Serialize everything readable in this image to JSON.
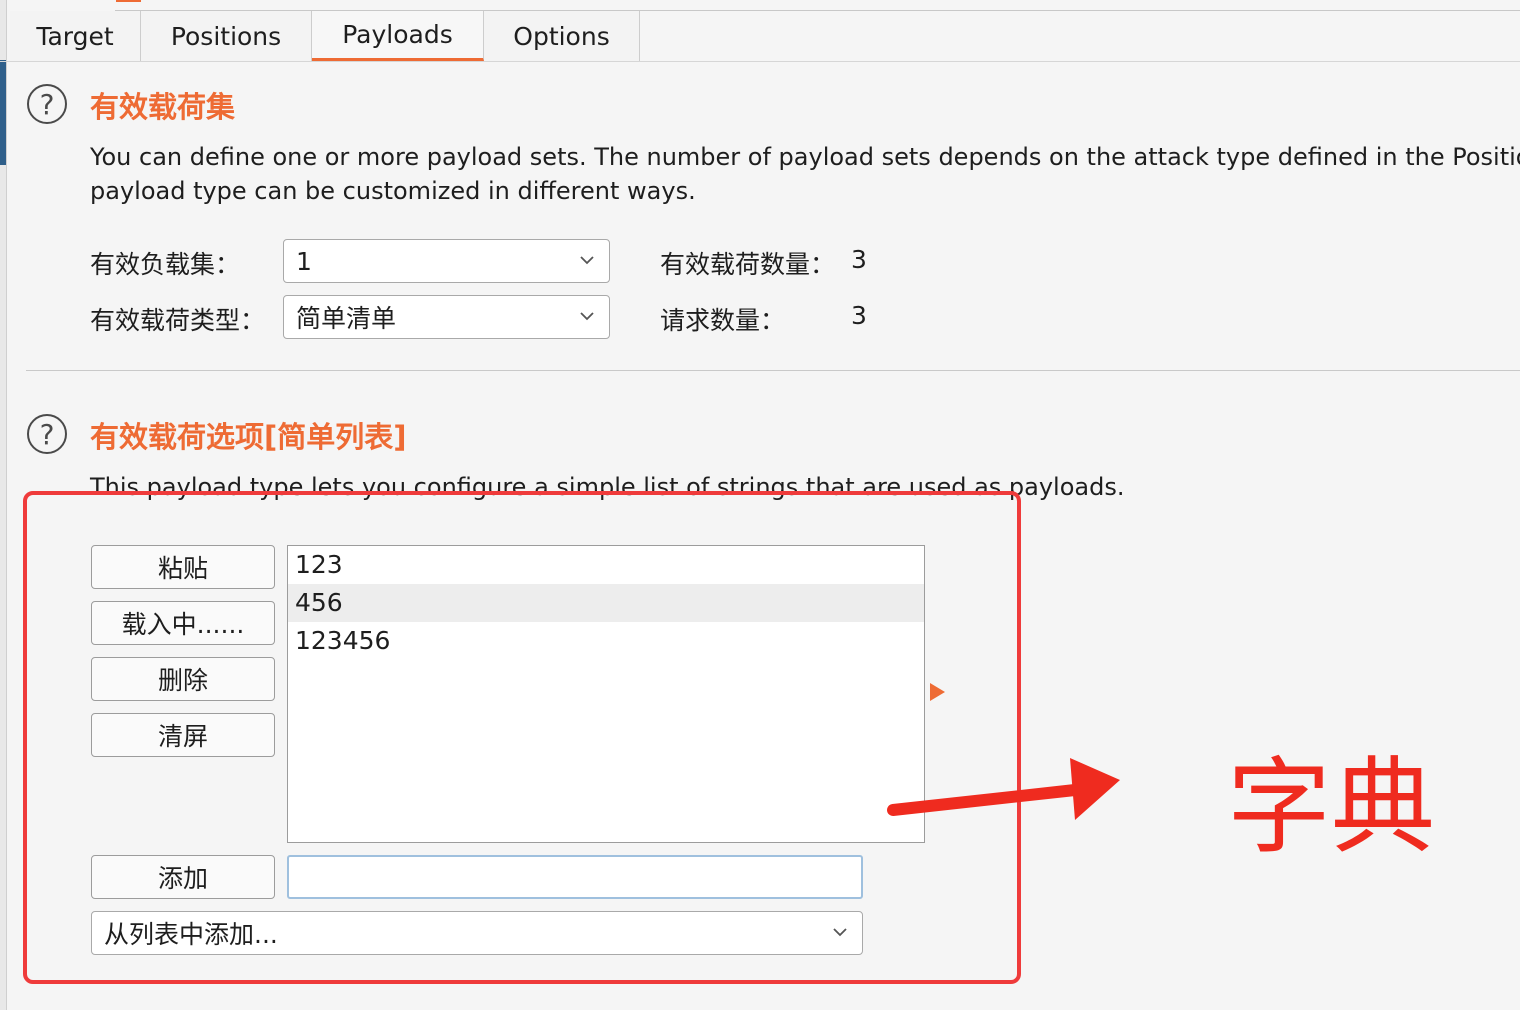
{
  "tabs": [
    {
      "label": "Target"
    },
    {
      "label": "Positions"
    },
    {
      "label": "Payloads",
      "active": true
    },
    {
      "label": "Options"
    }
  ],
  "payload_sets": {
    "help_icon": "?",
    "title": "有效载荷集",
    "description_line1": "You can define one or more payload sets. The number of payload sets depends on the attack type defined in the Positions",
    "description_line2": "payload type can be customized in different ways.",
    "set_label": "有效负载集：",
    "set_value": "1",
    "type_label": "有效载荷类型：",
    "type_value": "简单清单",
    "count_label": "有效载荷数量：",
    "count_value": "3",
    "requests_label": "请求数量：",
    "requests_value": "3"
  },
  "payload_options": {
    "help_icon": "?",
    "title": "有效载荷选项[简单列表]",
    "description": "This payload type lets you configure a simple list of strings that are used as payloads.",
    "buttons": {
      "paste": "粘贴",
      "load": "载入中......",
      "remove": "删除",
      "clear": "清屏",
      "add": "添加"
    },
    "items": [
      "123",
      "456",
      "123456"
    ],
    "selected_index": 1,
    "add_input_value": "",
    "add_from_list": "从列表中添加..."
  },
  "annotation": {
    "text": "字典",
    "color": "#ef2b1f"
  },
  "colors": {
    "accent": "#ee6b34",
    "annotation_red": "#ef3b3b"
  }
}
